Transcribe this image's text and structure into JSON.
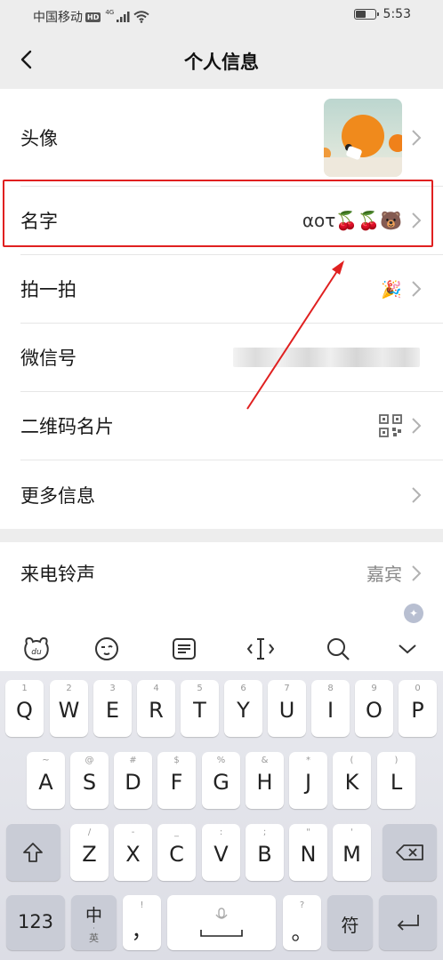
{
  "status_bar": {
    "carrier": "中国移动",
    "hd": "HD",
    "network": "4G",
    "time": "5:53",
    "battery_level": 0.55
  },
  "nav": {
    "title": "个人信息"
  },
  "profile_rows": [
    {
      "label": "头像"
    },
    {
      "label": "名字",
      "value": "αoτ🍒🍒🐻"
    },
    {
      "label": "拍一拍",
      "value": "🎉"
    },
    {
      "label": "微信号"
    },
    {
      "label": "二维码名片"
    },
    {
      "label": "更多信息"
    }
  ],
  "ringtone": {
    "label": "来电铃声",
    "value": "嘉宾"
  },
  "keyboard": {
    "toolbar_icons": [
      "keyboard-skin-icon",
      "emoji-icon",
      "clipboard-icon",
      "cursor-icon",
      "search-icon",
      "collapse-icon"
    ],
    "row1": [
      {
        "main": "Q",
        "sub": "1"
      },
      {
        "main": "W",
        "sub": "2"
      },
      {
        "main": "E",
        "sub": "3"
      },
      {
        "main": "R",
        "sub": "4"
      },
      {
        "main": "T",
        "sub": "5"
      },
      {
        "main": "Y",
        "sub": "6"
      },
      {
        "main": "U",
        "sub": "7"
      },
      {
        "main": "I",
        "sub": "8"
      },
      {
        "main": "O",
        "sub": "9"
      },
      {
        "main": "P",
        "sub": "0"
      }
    ],
    "row2": [
      {
        "main": "A",
        "sub": "~"
      },
      {
        "main": "S",
        "sub": "@"
      },
      {
        "main": "D",
        "sub": "#"
      },
      {
        "main": "F",
        "sub": "$"
      },
      {
        "main": "G",
        "sub": "%"
      },
      {
        "main": "H",
        "sub": "&"
      },
      {
        "main": "J",
        "sub": "*"
      },
      {
        "main": "K",
        "sub": "("
      },
      {
        "main": "L",
        "sub": ")"
      }
    ],
    "row3": [
      {
        "main": "Z",
        "sub": "/"
      },
      {
        "main": "X",
        "sub": "-"
      },
      {
        "main": "C",
        "sub": "_"
      },
      {
        "main": "V",
        "sub": ":"
      },
      {
        "main": "B",
        "sub": ";"
      },
      {
        "main": "N",
        "sub": "\""
      },
      {
        "main": "M",
        "sub": "'"
      }
    ],
    "numbers_key": "123",
    "lang_key_main": "中",
    "lang_key_sub": "英",
    "comma_key": "，",
    "comma_sub": "!",
    "period_key": "。",
    "period_sub": "?",
    "symbol_key": "符"
  },
  "colors": {
    "highlight": "#e02020",
    "background": "#ededed"
  }
}
